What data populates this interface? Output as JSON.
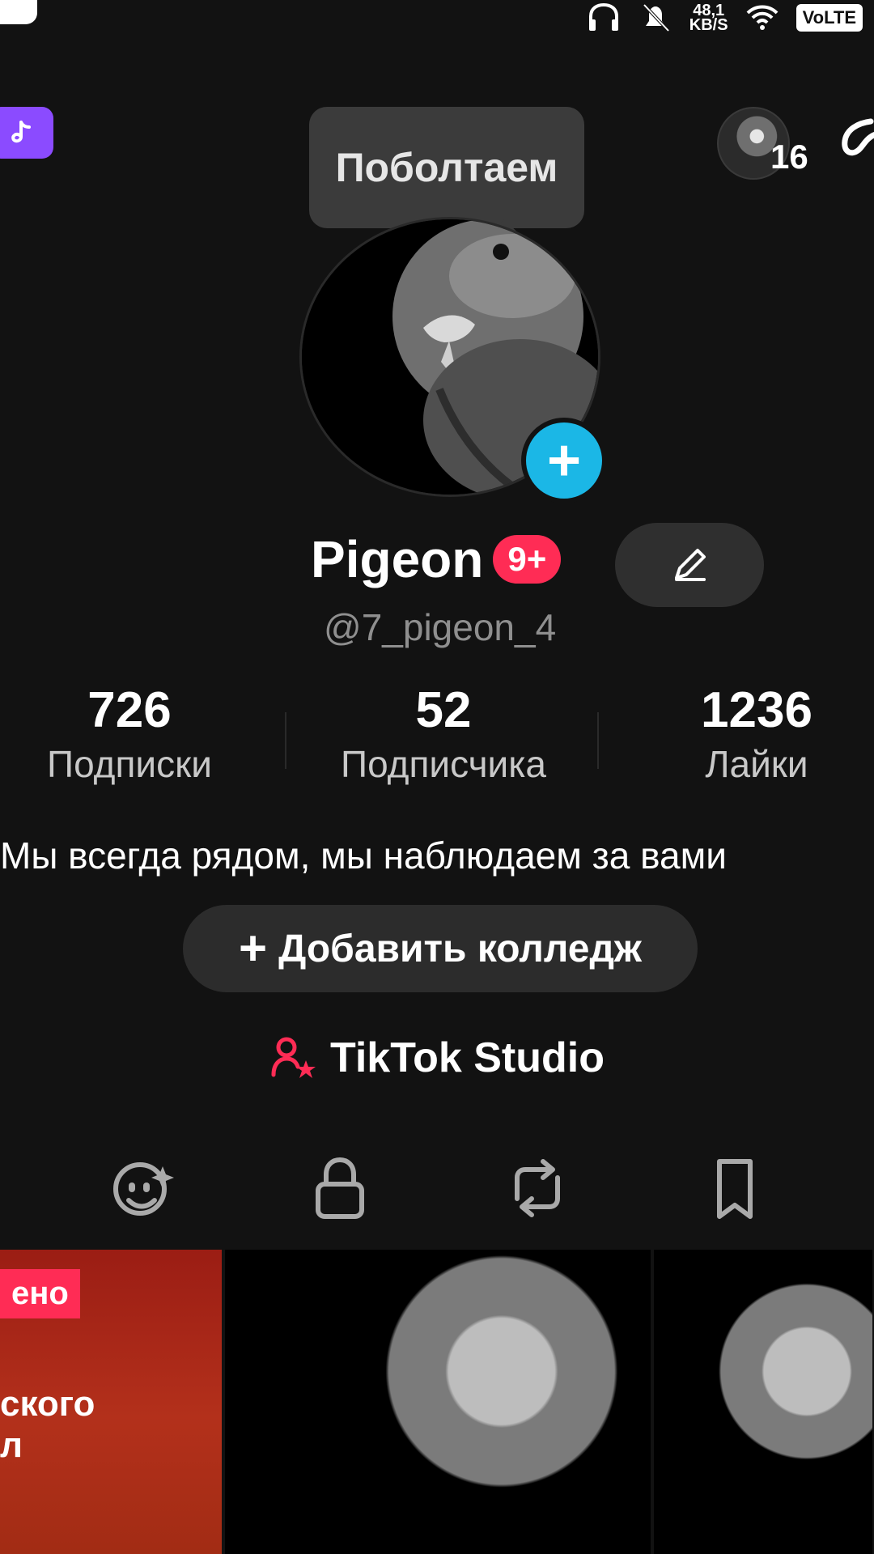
{
  "status": {
    "netspeed_value": "48,1",
    "netspeed_unit": "KB/S",
    "volte": "VoLTE"
  },
  "top": {
    "tooltip": "Поболтаем",
    "friends_count": "16"
  },
  "profile": {
    "name": "Pigeon",
    "badge": "9+",
    "handle": "@7_pigeon_4",
    "bio": "Мы всегда рядом, мы наблюдаем за вами"
  },
  "stats": [
    {
      "value": "726",
      "label": "Подписки"
    },
    {
      "value": "52",
      "label": "Подписчика"
    },
    {
      "value": "1236",
      "label": "Лайки"
    }
  ],
  "actions": {
    "add_college": "Добавить колледж",
    "tiktok_studio": "TikTok Studio"
  },
  "grid": {
    "tile1_label": "ено",
    "tile1_text_line1": "ского",
    "tile1_text_line2": "л"
  },
  "colors": {
    "background": "#121212",
    "accent_red": "#ff2c55",
    "accent_cyan": "#1bb7e6",
    "tiktok_purple": "#8b4bff"
  },
  "icons": {
    "tab1": "smile-sparkle-icon",
    "tab2": "lock-icon",
    "tab3": "repost-icon",
    "tab4": "bookmark-icon"
  }
}
